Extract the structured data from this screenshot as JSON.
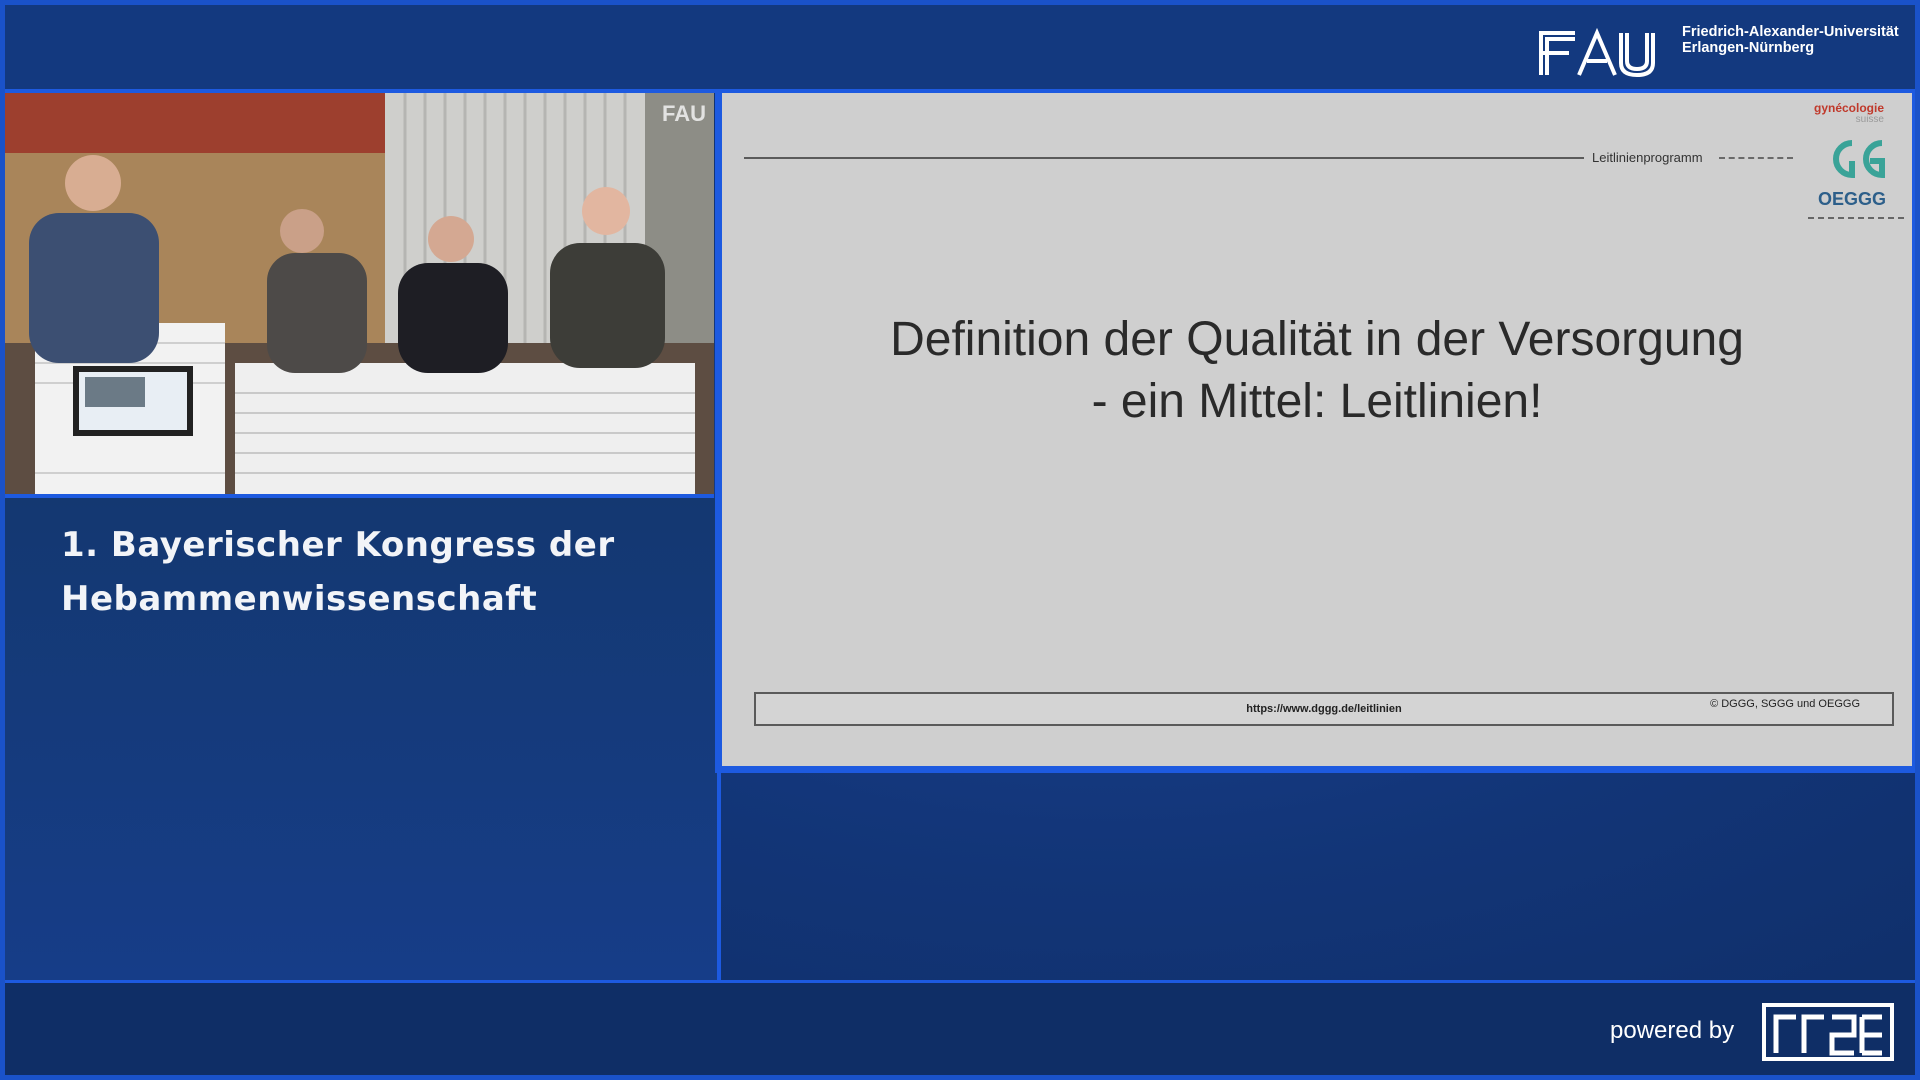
{
  "header": {
    "university_line1": "Friedrich-Alexander-Universität",
    "university_line2": "Erlangen-Nürnberg",
    "logo_text": "FAU"
  },
  "video": {
    "watermark": "FAU",
    "podium_logo": "FAU"
  },
  "left_panel": {
    "title_line1": "1. Bayerischer Kongress der",
    "title_line2": "Hebammenwissenschaft"
  },
  "slide": {
    "header_label": "Leitlinienprogramm",
    "partner_top": "gynécologie",
    "partner_sub": "suisse",
    "partner_bottom": "OEGGG",
    "title_line1": "Definition der Qualität in der Versorgung",
    "title_line2": "- ein Mittel: Leitlinien!",
    "footer_url": "https://www.dggg.de/leitlinien",
    "footer_copyright": "© DGGG, SGGG und OEGGG"
  },
  "footer": {
    "powered_by": "powered by",
    "logo_name": "rrze-logo"
  },
  "colors": {
    "accent": "#1d5ae0",
    "background": "#13397f",
    "slide": "#cfcfcf"
  }
}
